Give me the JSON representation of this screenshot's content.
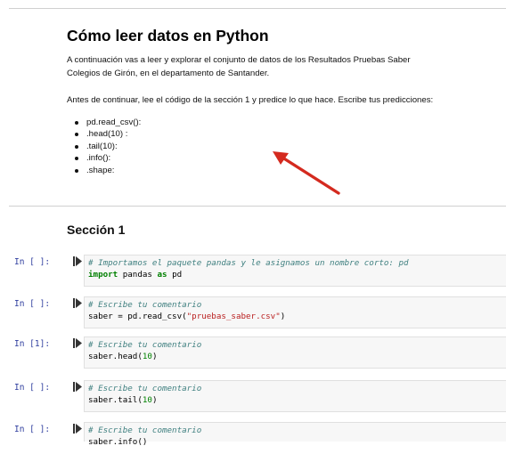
{
  "markdown": {
    "title": "Cómo leer datos en Python",
    "paragraph1_line1": "A continuación vas a leer y explorar el conjunto de datos de los Resultados Pruebas Saber",
    "paragraph1_line2": "Colegios de Girón, en el departamento de Santander.",
    "paragraph2": "Antes de continuar, lee el código de la sección 1 y predice lo que hace. Escribe tus predicciones:",
    "list": [
      "pd.read_csv():",
      ".head(10) :",
      ".tail(10):",
      ".info():",
      ".shape:"
    ],
    "section_heading": "Sección 1"
  },
  "colors": {
    "prompt": "#303f9f",
    "arrow": "#d42a1f",
    "comment": "#408080"
  },
  "cells": [
    {
      "prompt": "In [ ]:",
      "comment": "# Importamos el paquete pandas y le asignamos un nombre corto: pd",
      "code_kw1": "import",
      "code_mid": " pandas ",
      "code_kw2": "as",
      "code_end": " pd"
    },
    {
      "prompt": "In [ ]:",
      "comment": "# Escribe tu comentario",
      "code_pre": "saber = pd.read_csv(",
      "code_str": "\"pruebas_saber.csv\"",
      "code_post": ")"
    },
    {
      "prompt": "In [1]:",
      "comment": "# Escribe tu comentario",
      "code_pre": "saber.head(",
      "code_num": "10",
      "code_post": ")"
    },
    {
      "prompt": "In [ ]:",
      "comment": "# Escribe tu comentario",
      "code_pre": "saber.tail(",
      "code_num": "10",
      "code_post": ")"
    },
    {
      "prompt": "In [ ]:",
      "comment": "# Escribe tu comentario",
      "code_pre": "saber.info()"
    }
  ]
}
